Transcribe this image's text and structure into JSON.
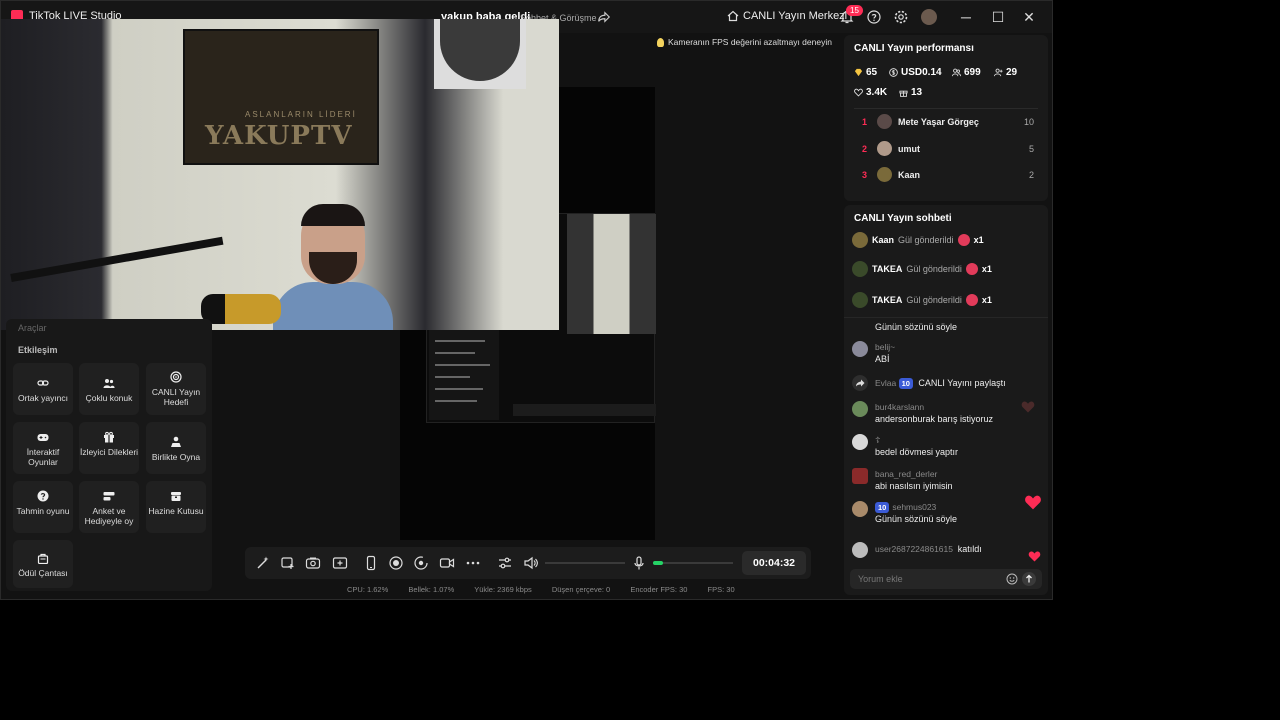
{
  "app": {
    "title": "TikTok LIVE Studio"
  },
  "stream": {
    "title": "yakup baba geldi",
    "category": "Sohbet & Görüşme"
  },
  "header": {
    "live_center_label": "CANLI Yayın Merkezi",
    "notification_count": "15"
  },
  "tip": {
    "text": "Kameranın FPS değerini azaltmayı deneyin"
  },
  "camera": {
    "poster_text": "YAKUPTV",
    "poster_subtext": "ASLANLARIN LİDERİ"
  },
  "interaction": {
    "title": "Etkileşim",
    "partial_label": "Araçlar",
    "tiles": [
      {
        "label": "Ortak yayıncı",
        "icon": "link-icon"
      },
      {
        "label": "Çoklu konuk",
        "icon": "users-icon"
      },
      {
        "label": "CANLI Yayın Hedefi",
        "icon": "target-icon"
      },
      {
        "label": "İnteraktif Oyunlar",
        "icon": "gamepad-icon"
      },
      {
        "label": "İzleyici Dilekleri",
        "icon": "gift-icon"
      },
      {
        "label": "Birlikte Oyna",
        "icon": "play-together-icon"
      },
      {
        "label": "Tahmin oyunu",
        "icon": "question-icon"
      },
      {
        "label": "Anket ve Hediyeyle oy",
        "icon": "poll-icon"
      },
      {
        "label": "Hazine Kutusu",
        "icon": "treasure-icon"
      },
      {
        "label": "Ödül Çantası",
        "icon": "bag-icon"
      }
    ]
  },
  "controls": {
    "timer": "00:04:32",
    "mic_level": 0.12
  },
  "status": {
    "cpu": "CPU:  1.62%",
    "memory": "Bellek:  1.07%",
    "upload": "Yükle:  2369 kbps",
    "dropped": "Düşen çerçeve:  0",
    "encoder_fps": "Encoder FPS:  30",
    "fps": "FPS:  30"
  },
  "performance": {
    "title": "CANLI Yayın performansı",
    "diamonds": "65",
    "usd": "USD0.14",
    "viewers": "699",
    "new_followers": "29",
    "likes": "3.4K",
    "gifts": "13",
    "ranking": [
      {
        "rank": "1",
        "name": "Mete Yaşar Görgeç",
        "score": "10",
        "color": "#5a4a48"
      },
      {
        "rank": "2",
        "name": "umut",
        "score": "5",
        "color": "#b09a8a"
      },
      {
        "rank": "3",
        "name": "Kaan",
        "score": "2",
        "color": "#7a6a3a"
      }
    ]
  },
  "chat": {
    "title": "CANLI Yayın sohbeti",
    "gifts": [
      {
        "name": "Kaan",
        "action": "Gül gönderildi",
        "count": "x1"
      },
      {
        "name": "TAKEA",
        "action": "Gül gönderildi",
        "count": "x1"
      },
      {
        "name": "TAKEA",
        "action": "Gül gönderildi",
        "count": "x1"
      }
    ],
    "messages": [
      {
        "user": "",
        "text": "Günün sözünü söyle"
      },
      {
        "user": "belij~",
        "text": "ABİ"
      },
      {
        "user": "Evlaa",
        "level": "10",
        "text": "CANLI Yayını paylaştı"
      },
      {
        "user": "bur4karslann",
        "text": "andersonburak barış istiyoruz"
      },
      {
        "user": "☦",
        "text": "bedel dövmesi yaptır"
      },
      {
        "user": "bana_red_derler",
        "text": "abi nasılsın iyimisin"
      },
      {
        "user": "sehmus023",
        "level": "10",
        "text": "Günün sözünü söyle"
      },
      {
        "user": "user2687224861615",
        "text": "katıldı"
      }
    ],
    "comment_placeholder": "Yorum ekle"
  },
  "colors": {
    "accent": "#fe2c55",
    "mic_level": "#25d366",
    "level_badge": "#3b5bd6"
  }
}
